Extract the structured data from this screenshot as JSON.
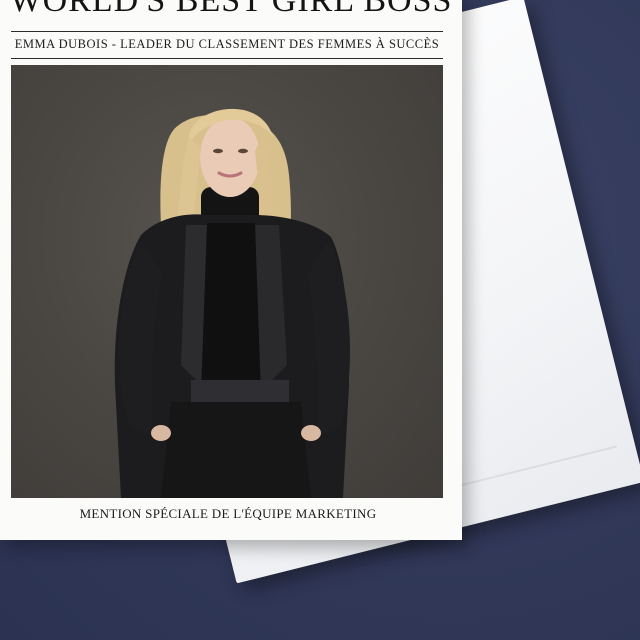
{
  "card": {
    "title": "WORLD'S BEST GIRL BOSS",
    "subtitle": "EMMA DUBOIS - LEADER DU CLASSEMENT DES FEMMES À SUCCÈS",
    "caption": "MENTION SPÉCIALE DE L'ÉQUIPE MARKETING"
  },
  "photo": {
    "subject": "portrait of a blonde woman in a black suit and black turtleneck against a grey backdrop"
  },
  "colors": {
    "background": "#323a5c",
    "card": "#fbfbfa",
    "envelope": "#f4f5f7",
    "photo_backdrop": "#4a4743",
    "text": "#141414"
  }
}
